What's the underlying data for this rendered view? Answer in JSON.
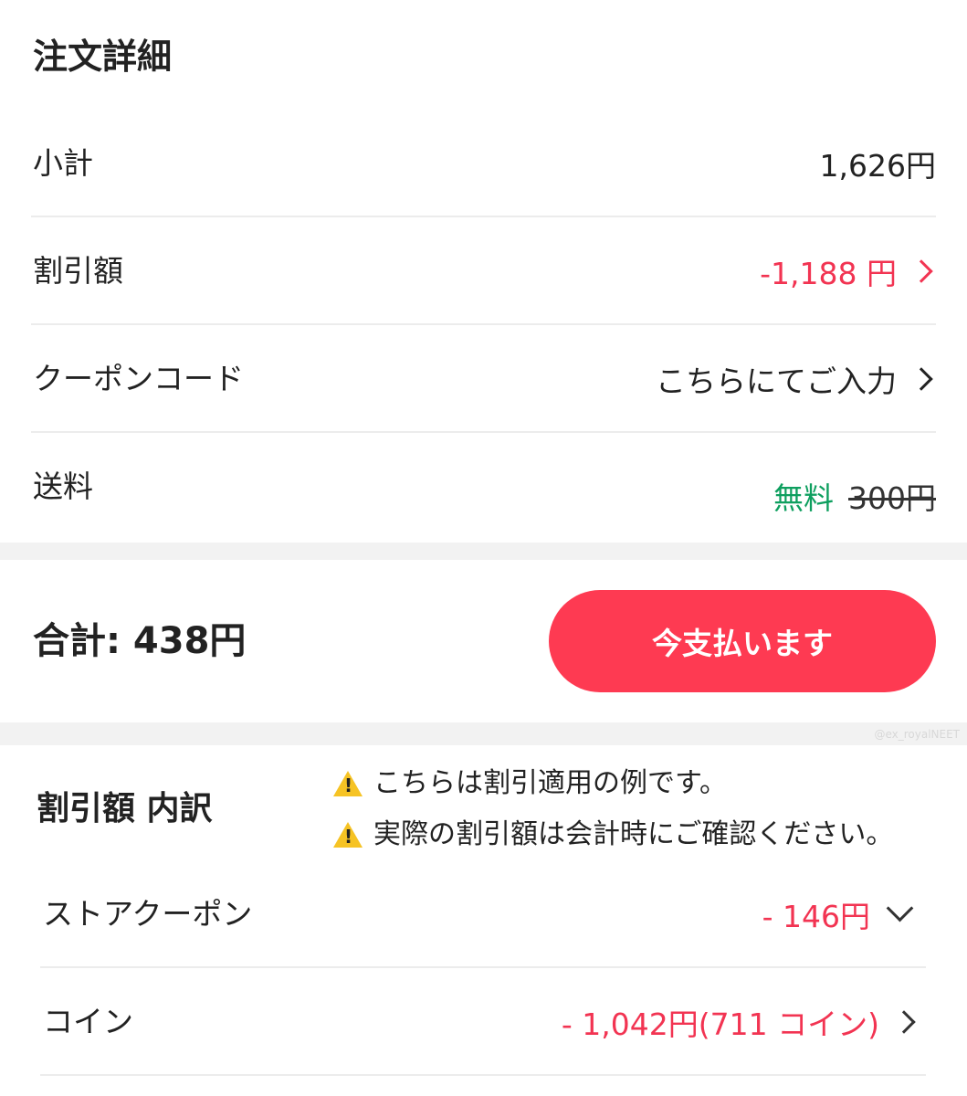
{
  "order": {
    "title": "注文詳細",
    "subtotal_label": "小計",
    "subtotal_value": "1,626円",
    "discount_label": "割引額",
    "discount_value": "-1,188 円",
    "coupon_label": "クーポンコード",
    "coupon_value": "こちらにてご入力",
    "shipping_label": "送料",
    "shipping_free": "無料",
    "shipping_original": "300円"
  },
  "total": {
    "label": "合計: 438円",
    "pay_button": "今支払います"
  },
  "watermark": "@ex_royalNEET",
  "breakdown": {
    "title": "割引額 内訳",
    "notices": [
      "こちらは割引適用の例です。",
      "実際の割引額は会計時にご確認ください。"
    ],
    "store_coupon_label": "ストアクーポン",
    "store_coupon_value": "- 146円",
    "coin_label": "コイン",
    "coin_value": "- 1,042円(711 コイン)"
  },
  "colors": {
    "accent": "#fe3a52",
    "discount_red": "#f23452",
    "free_green": "#0e9f5f",
    "warning": "#f6c324"
  },
  "icons": [
    "chevron-right-icon",
    "chevron-down-icon",
    "warning-icon"
  ]
}
